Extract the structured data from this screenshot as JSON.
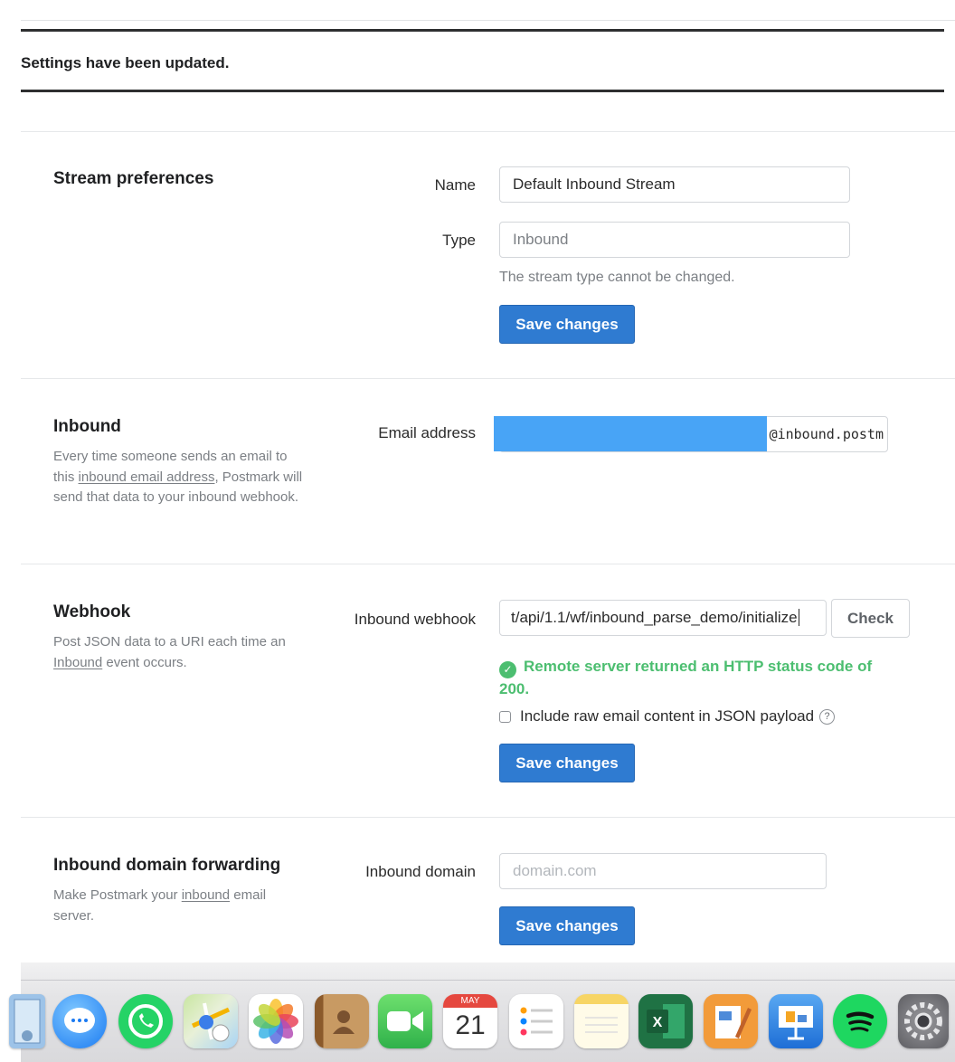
{
  "flash": {
    "message": "Settings have been updated."
  },
  "stream_preferences": {
    "title": "Stream preferences",
    "name_label": "Name",
    "name_value": "Default Inbound Stream",
    "type_label": "Type",
    "type_value": "Inbound",
    "type_help": "The stream type cannot be changed.",
    "save_label": "Save changes"
  },
  "inbound": {
    "title": "Inbound",
    "desc_1": "Every time someone sends an email to this ",
    "desc_link": "inbound email address",
    "desc_2": ", Postmark will send that data to your inbound webhook.",
    "email_label": "Email address",
    "email_value_visible": "@inbound.postm"
  },
  "webhook": {
    "title": "Webhook",
    "desc_1": "Post JSON data to a URI each time an ",
    "desc_link": "Inbound",
    "desc_2": " event occurs.",
    "url_label": "Inbound webhook",
    "url_value": "t/api/1.1/wf/inbound_parse_demo/initialize",
    "check_label": "Check",
    "success_message": "Remote server returned an HTTP status code of 200.",
    "raw_content_label": "Include raw email content in JSON payload",
    "raw_content_checked": false,
    "save_label": "Save changes"
  },
  "domain_forwarding": {
    "title": "Inbound domain forwarding",
    "desc_1": "Make Postmark your ",
    "desc_link": "inbound",
    "desc_2": " email server.",
    "domain_label": "Inbound domain",
    "domain_placeholder": "domain.com",
    "save_label": "Save changes"
  },
  "dock": {
    "apps": [
      "Preview",
      "Messages",
      "WhatsApp",
      "Maps",
      "Photos",
      "Contacts",
      "FaceTime",
      "Calendar",
      "Reminders",
      "Notes",
      "Excel",
      "Pages",
      "Keynote",
      "Spotify",
      "System Preferences"
    ],
    "calendar_month": "MAY",
    "calendar_day": "21"
  },
  "colors": {
    "primary_button": "#2f7bd1",
    "success": "#4cbe70",
    "redaction": "#48a4f6"
  }
}
